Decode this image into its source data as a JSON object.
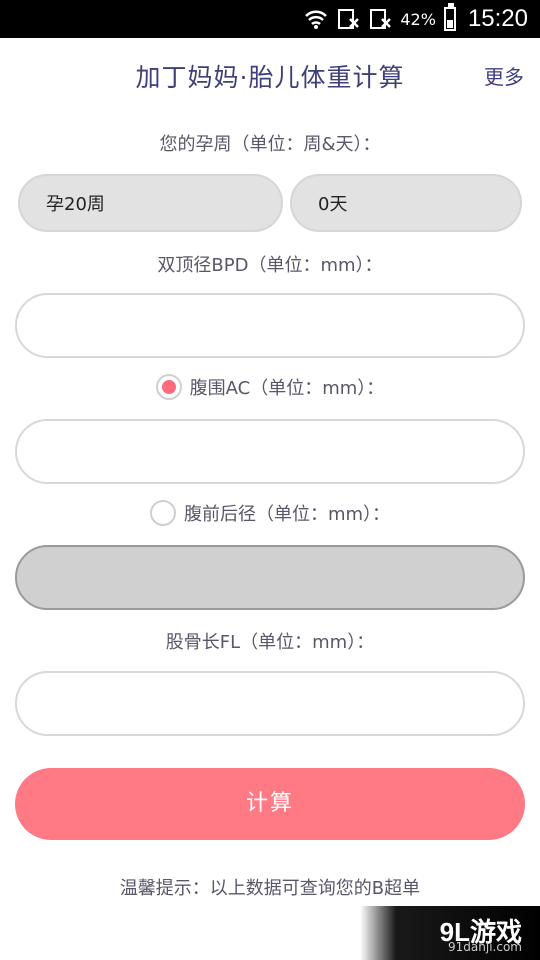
{
  "status_bar": {
    "battery": "42%",
    "time": "15:20"
  },
  "header": {
    "title": "加丁妈妈·胎儿体重计算",
    "more": "更多"
  },
  "fields": {
    "week_label": "您的孕周（单位：周&天）：",
    "week_value": "孕20周",
    "day_value": "0天",
    "bpd_label": "双顶径BPD（单位：mm）：",
    "ac_label": "腹围AC（单位：mm）：",
    "apd_label": "腹前后径（单位：mm）：",
    "fl_label": "股骨长FL（单位：mm）："
  },
  "calc_button": "计算",
  "tip": "温馨提示：以上数据可查询您的B超单",
  "watermark": {
    "logo": "9L游戏",
    "url": "91danji.com"
  },
  "colors": {
    "accent": "#ff7a85",
    "title": "#3f3f7a"
  }
}
